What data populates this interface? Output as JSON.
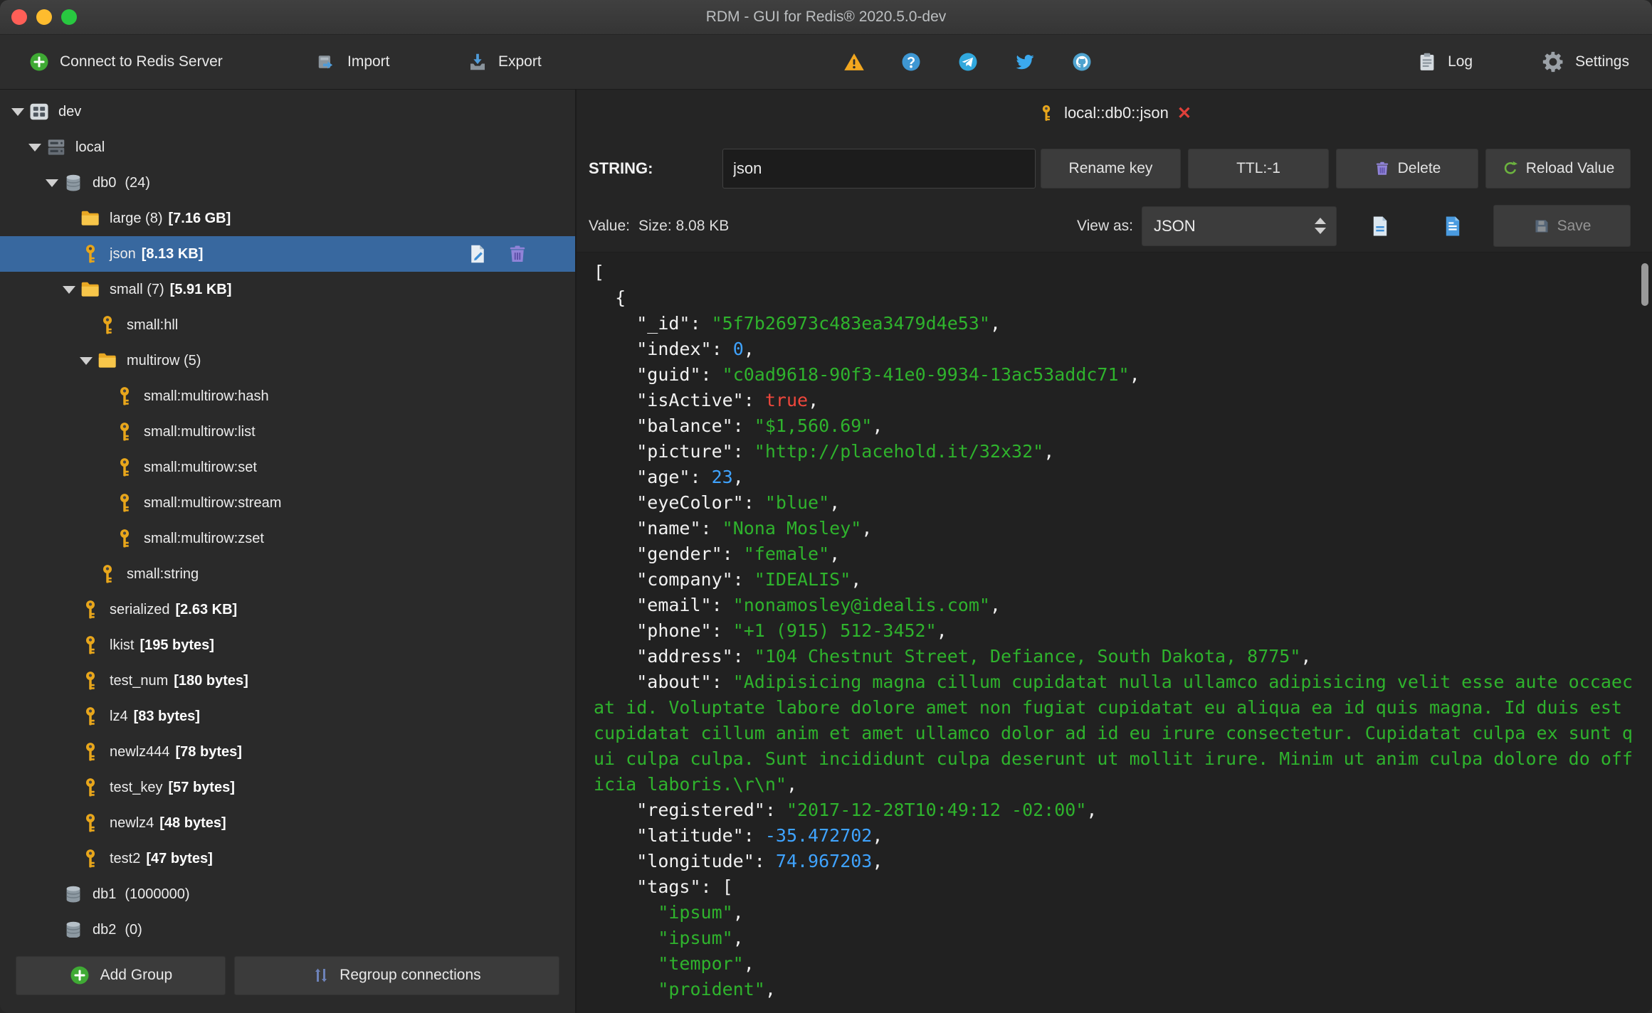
{
  "window": {
    "title": "RDM - GUI for Redis® 2020.5.0-dev"
  },
  "toolbar": {
    "connect_label": "Connect to Redis Server",
    "import_label": "Import",
    "export_label": "Export",
    "log_label": "Log",
    "settings_label": "Settings"
  },
  "sidebar": {
    "add_group_label": "Add Group",
    "regroup_label": "Regroup connections",
    "tree": [
      {
        "level": 0,
        "icon": "grid",
        "arrow": true,
        "name": "dev"
      },
      {
        "level": 1,
        "icon": "host",
        "arrow": true,
        "name": "local"
      },
      {
        "level": 2,
        "icon": "database",
        "arrow": true,
        "name": "db0",
        "count": "(24)"
      },
      {
        "level": 3,
        "icon": "folder",
        "name": "large (8)",
        "size": "[7.16 GB]"
      },
      {
        "level": 3,
        "icon": "key",
        "name": "json",
        "size": "[8.13 KB]",
        "selected": true,
        "actions": true
      },
      {
        "level": 3,
        "icon": "folder",
        "arrow": true,
        "name": "small (7)",
        "size": "[5.91 KB]"
      },
      {
        "level": 4,
        "icon": "key",
        "name": "small:hll"
      },
      {
        "level": 4,
        "icon": "folder",
        "arrow": true,
        "name": "multirow (5)"
      },
      {
        "level": 5,
        "icon": "key",
        "name": "small:multirow:hash"
      },
      {
        "level": 5,
        "icon": "key",
        "name": "small:multirow:list"
      },
      {
        "level": 5,
        "icon": "key",
        "name": "small:multirow:set"
      },
      {
        "level": 5,
        "icon": "key",
        "name": "small:multirow:stream"
      },
      {
        "level": 5,
        "icon": "key",
        "name": "small:multirow:zset"
      },
      {
        "level": 4,
        "icon": "key",
        "name": "small:string"
      },
      {
        "level": 3,
        "icon": "key",
        "name": "serialized",
        "size": "[2.63 KB]"
      },
      {
        "level": 3,
        "icon": "key",
        "name": "lkist",
        "size": "[195 bytes]"
      },
      {
        "level": 3,
        "icon": "key",
        "name": "test_num",
        "size": "[180 bytes]"
      },
      {
        "level": 3,
        "icon": "key",
        "name": "lz4",
        "size": "[83 bytes]"
      },
      {
        "level": 3,
        "icon": "key",
        "name": "newlz444",
        "size": "[78 bytes]"
      },
      {
        "level": 3,
        "icon": "key",
        "name": "test_key",
        "size": "[57 bytes]"
      },
      {
        "level": 3,
        "icon": "key",
        "name": "newlz4",
        "size": "[48 bytes]"
      },
      {
        "level": 3,
        "icon": "key",
        "name": "test2",
        "size": "[47 bytes]"
      },
      {
        "level": 2,
        "icon": "database",
        "name": "db1",
        "count": "(1000000)"
      },
      {
        "level": 2,
        "icon": "database",
        "name": "db2",
        "count": "(0)"
      }
    ]
  },
  "main": {
    "tab": {
      "label": "local::db0::json"
    },
    "key_bar": {
      "type_label": "STRING:",
      "key_value": "json",
      "rename_label": "Rename key",
      "ttl_label": "TTL:-1",
      "delete_label": "Delete",
      "reload_label": "Reload Value"
    },
    "value_bar": {
      "value_label": "Value:",
      "size_text": "Size: 8.08 KB",
      "view_as_label": "View as:",
      "view_as_value": "JSON",
      "save_label": "Save"
    },
    "viewer": {
      "lines": [
        [
          [
            "p",
            "["
          ]
        ],
        [
          [
            "p",
            "  {"
          ]
        ],
        [
          [
            "p",
            "    \"_id\": "
          ],
          [
            "s",
            "\"5f7b26973c483ea3479d4e53\""
          ],
          [
            "p",
            ","
          ]
        ],
        [
          [
            "p",
            "    \"index\": "
          ],
          [
            "n",
            "0"
          ],
          [
            "p",
            ","
          ]
        ],
        [
          [
            "p",
            "    \"guid\": "
          ],
          [
            "s",
            "\"c0ad9618-90f3-41e0-9934-13ac53addc71\""
          ],
          [
            "p",
            ","
          ]
        ],
        [
          [
            "p",
            "    \"isActive\": "
          ],
          [
            "b",
            "true"
          ],
          [
            "p",
            ","
          ]
        ],
        [
          [
            "p",
            "    \"balance\": "
          ],
          [
            "s",
            "\"$1,560.69\""
          ],
          [
            "p",
            ","
          ]
        ],
        [
          [
            "p",
            "    \"picture\": "
          ],
          [
            "s",
            "\"http://placehold.it/32x32\""
          ],
          [
            "p",
            ","
          ]
        ],
        [
          [
            "p",
            "    \"age\": "
          ],
          [
            "n",
            "23"
          ],
          [
            "p",
            ","
          ]
        ],
        [
          [
            "p",
            "    \"eyeColor\": "
          ],
          [
            "s",
            "\"blue\""
          ],
          [
            "p",
            ","
          ]
        ],
        [
          [
            "p",
            "    \"name\": "
          ],
          [
            "s",
            "\"Nona Mosley\""
          ],
          [
            "p",
            ","
          ]
        ],
        [
          [
            "p",
            "    \"gender\": "
          ],
          [
            "s",
            "\"female\""
          ],
          [
            "p",
            ","
          ]
        ],
        [
          [
            "p",
            "    \"company\": "
          ],
          [
            "s",
            "\"IDEALIS\""
          ],
          [
            "p",
            ","
          ]
        ],
        [
          [
            "p",
            "    \"email\": "
          ],
          [
            "s",
            "\"nonamosley@idealis.com\""
          ],
          [
            "p",
            ","
          ]
        ],
        [
          [
            "p",
            "    \"phone\": "
          ],
          [
            "s",
            "\"+1 (915) 512-3452\""
          ],
          [
            "p",
            ","
          ]
        ],
        [
          [
            "p",
            "    \"address\": "
          ],
          [
            "s",
            "\"104 Chestnut Street, Defiance, South Dakota, 8775\""
          ],
          [
            "p",
            ","
          ]
        ],
        [
          [
            "p",
            "    \"about\": "
          ],
          [
            "s",
            "\"Adipisicing magna cillum cupidatat nulla ullamco adipisicing velit esse aute occaecat id. Voluptate labore dolore amet non fugiat cupidatat eu aliqua ea id quis magna. Id duis est cupidatat cillum anim et amet ullamco dolor ad id eu irure consectetur. Cupidatat culpa ex sunt qui culpa culpa. Sunt incididunt culpa deserunt ut mollit irure. Minim ut anim culpa dolore do officia laboris.\\r\\n\""
          ],
          [
            "p",
            ","
          ]
        ],
        [
          [
            "p",
            "    \"registered\": "
          ],
          [
            "s",
            "\"2017-12-28T10:49:12 -02:00\""
          ],
          [
            "p",
            ","
          ]
        ],
        [
          [
            "p",
            "    \"latitude\": "
          ],
          [
            "n",
            "-35.472702"
          ],
          [
            "p",
            ","
          ]
        ],
        [
          [
            "p",
            "    \"longitude\": "
          ],
          [
            "n",
            "74.967203"
          ],
          [
            "p",
            ","
          ]
        ],
        [
          [
            "p",
            "    \"tags\": ["
          ]
        ],
        [
          [
            "p",
            "      "
          ],
          [
            "s",
            "\"ipsum\""
          ],
          [
            "p",
            ","
          ]
        ],
        [
          [
            "p",
            "      "
          ],
          [
            "s",
            "\"ipsum\""
          ],
          [
            "p",
            ","
          ]
        ],
        [
          [
            "p",
            "      "
          ],
          [
            "s",
            "\"tempor\""
          ],
          [
            "p",
            ","
          ]
        ],
        [
          [
            "p",
            "      "
          ],
          [
            "s",
            "\"proident\""
          ],
          [
            "p",
            ","
          ]
        ]
      ]
    }
  },
  "colors": {
    "selection": "#38689f",
    "json_string": "#2fb32d",
    "json_number": "#3fa3ff",
    "json_bool": "#f0473c",
    "key_icon": "#e8a61b",
    "tab_close": "#e0403a"
  }
}
